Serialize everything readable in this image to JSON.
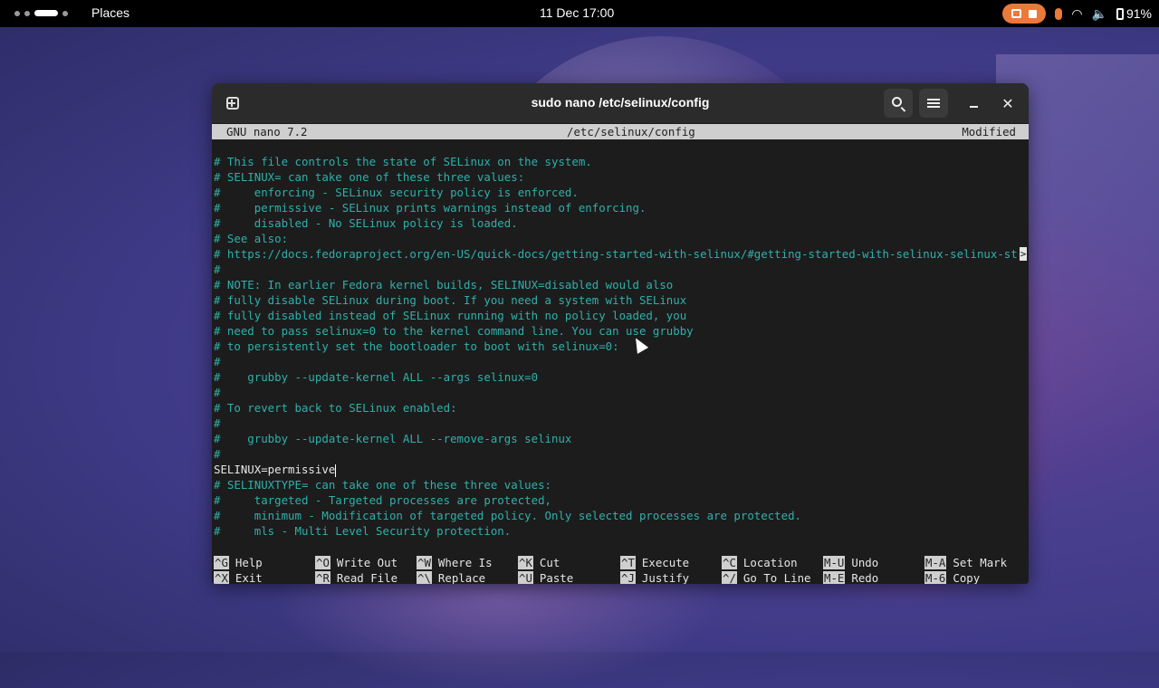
{
  "topbar": {
    "places_label": "Places",
    "clock": "11 Dec  17:00",
    "battery_label": "91%",
    "icons": [
      "screen-recorder-icon",
      "microphone-icon",
      "wifi-icon",
      "volume-icon",
      "battery-icon"
    ]
  },
  "window": {
    "title": "sudo nano /etc/selinux/config"
  },
  "nano": {
    "version": "GNU nano 7.2",
    "filename": "/etc/selinux/config",
    "status": "Modified",
    "lines": [
      "# This file controls the state of SELinux on the system.",
      "# SELINUX= can take one of these three values:",
      "#     enforcing - SELinux security policy is enforced.",
      "#     permissive - SELinux prints warnings instead of enforcing.",
      "#     disabled - No SELinux policy is loaded.",
      "# See also:",
      "# https://docs.fedoraproject.org/en-US/quick-docs/getting-started-with-selinux/#getting-started-with-selinux-selinux-st",
      "#",
      "# NOTE: In earlier Fedora kernel builds, SELINUX=disabled would also",
      "# fully disable SELinux during boot. If you need a system with SELinux",
      "# fully disabled instead of SELinux running with no policy loaded, you",
      "# need to pass selinux=0 to the kernel command line. You can use grubby",
      "# to persistently set the bootloader to boot with selinux=0:",
      "#",
      "#    grubby --update-kernel ALL --args selinux=0",
      "#",
      "# To revert back to SELinux enabled:",
      "#",
      "#    grubby --update-kernel ALL --remove-args selinux",
      "#",
      "SELINUX=permissive",
      "# SELINUXTYPE= can take one of these three values:",
      "#     targeted - Targeted processes are protected,",
      "#     minimum - Modification of targeted policy. Only selected processes are protected.",
      "#     mls - Multi Level Security protection."
    ],
    "overflow_marker": ">",
    "shortcuts": [
      {
        "key": "^G",
        "label": "Help"
      },
      {
        "key": "^O",
        "label": "Write Out"
      },
      {
        "key": "^W",
        "label": "Where Is"
      },
      {
        "key": "^K",
        "label": "Cut"
      },
      {
        "key": "^T",
        "label": "Execute"
      },
      {
        "key": "^C",
        "label": "Location"
      },
      {
        "key": "M-U",
        "label": "Undo"
      },
      {
        "key": "M-A",
        "label": "Set Mark"
      },
      {
        "key": "^X",
        "label": "Exit"
      },
      {
        "key": "^R",
        "label": "Read File"
      },
      {
        "key": "^\\",
        "label": "Replace"
      },
      {
        "key": "^U",
        "label": "Paste"
      },
      {
        "key": "^J",
        "label": "Justify"
      },
      {
        "key": "^/",
        "label": "Go To Line"
      },
      {
        "key": "M-E",
        "label": "Redo"
      },
      {
        "key": "M-6",
        "label": "Copy"
      }
    ]
  }
}
